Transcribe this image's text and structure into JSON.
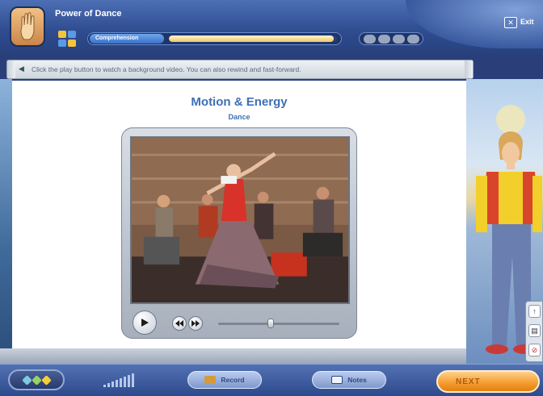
{
  "header": {
    "title": "Power of Dance",
    "progress_label": "Comprehension",
    "progress_fraction": 0.98,
    "step_pills": [
      "",
      "",
      "",
      ""
    ],
    "exit_label": "Exit"
  },
  "instructions": {
    "text": "Click the play button to watch a background video.  You can also rewind and fast-forward."
  },
  "content": {
    "title": "Motion & Energy",
    "subtitle": "Dance"
  },
  "video": {
    "slider_fraction": 0.43
  },
  "bottom": {
    "record_label": "Record",
    "notes_label": "Notes",
    "next_label": "NEXT"
  },
  "colors": {
    "accent_orange": "#f49a2d",
    "title_blue": "#3d6fb5",
    "header_blue": "#2f4c8f"
  },
  "icons": [
    "hand-icon",
    "grid-icon",
    "exit-icon",
    "play-icon",
    "rewind-icon",
    "fast-forward-icon",
    "record-icon",
    "notes-icon",
    "tools-icon",
    "volume-icon",
    "arrow-up-icon",
    "print-icon",
    "stop-icon"
  ]
}
